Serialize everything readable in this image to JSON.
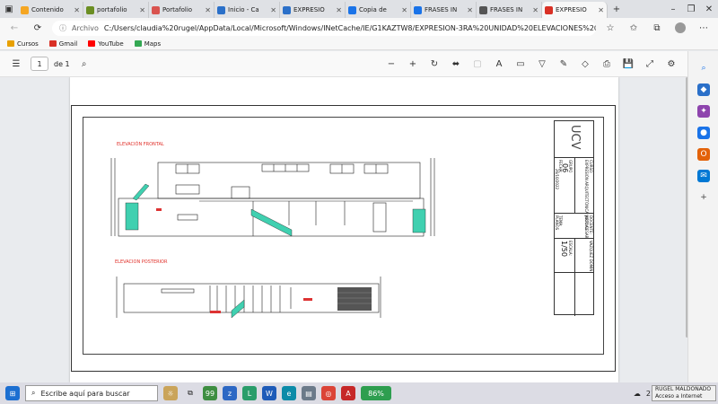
{
  "tabs": [
    {
      "title": "Contenido",
      "fav": "#f5a623",
      "active": false
    },
    {
      "title": "portafolio",
      "fav": "#6b8e23",
      "active": false
    },
    {
      "title": "Portafolio",
      "fav": "#d9534f",
      "active": false
    },
    {
      "title": "Inicio - Ca",
      "fav": "#2b70c9",
      "active": false
    },
    {
      "title": "EXPRESIÓ",
      "fav": "#2b70c9",
      "active": false
    },
    {
      "title": "Copia de",
      "fav": "#1a73e8",
      "active": false
    },
    {
      "title": "FRASES IN",
      "fav": "#1a73e8",
      "active": false
    },
    {
      "title": "FRASES IN",
      "fav": "#555555",
      "active": false
    },
    {
      "title": "EXPRESIÓ",
      "fav": "#d93025",
      "active": true
    }
  ],
  "address": {
    "label": "Archivo",
    "url": "C:/Users/claudia%20rugel/AppData/Local/Microsoft/Windows/INetCache/IE/G1KAZTW8/EXPRESION-3RA%20UNIDAD%20ELEVACIONES%20..."
  },
  "bookmarks": [
    {
      "label": "Cursos",
      "icon": "folder-icon",
      "color": "#e8a000"
    },
    {
      "label": "Gmail",
      "icon": "gmail-icon",
      "color": "#d93025"
    },
    {
      "label": "YouTube",
      "icon": "youtube-icon",
      "color": "#ff0000"
    },
    {
      "label": "Maps",
      "icon": "maps-icon",
      "color": "#34a853"
    }
  ],
  "pdf": {
    "page": "1",
    "of": "de 1"
  },
  "drawing": {
    "elev_front": "ELEVACIÓN FRONTAL",
    "elev_back": "ELEVACION POSTERIOR",
    "logo": "UCV",
    "curso_lbl": "CURSO:",
    "curso": "EXPRESIÓN ARQUITECTÓNICA VIRTUAL",
    "grupo_lbl": "GRUPO",
    "grupo": "06",
    "fecha_lbl": "FECHA:",
    "fecha": "26/10/2022",
    "docente_lbl": "DOCENTE:",
    "docente": "JULIO CESAR",
    "tema_lbl": "TEMA:",
    "tema": "PLANOS",
    "escala_lbl": "ESCALA:",
    "escala": "1/50",
    "autor": "VAZQUEZ DOMIN"
  },
  "taskbar": {
    "search_placeholder": "Escribe aquí para buscar",
    "battery": "86%",
    "temp": "21°C",
    "notif_line1": "RUGEL MALDONADO",
    "notif_line2": "Acceso a Internet"
  },
  "colors": {
    "accent": "#1a73e8",
    "red_label": "#e0302a",
    "stair": "#40d0b0"
  }
}
